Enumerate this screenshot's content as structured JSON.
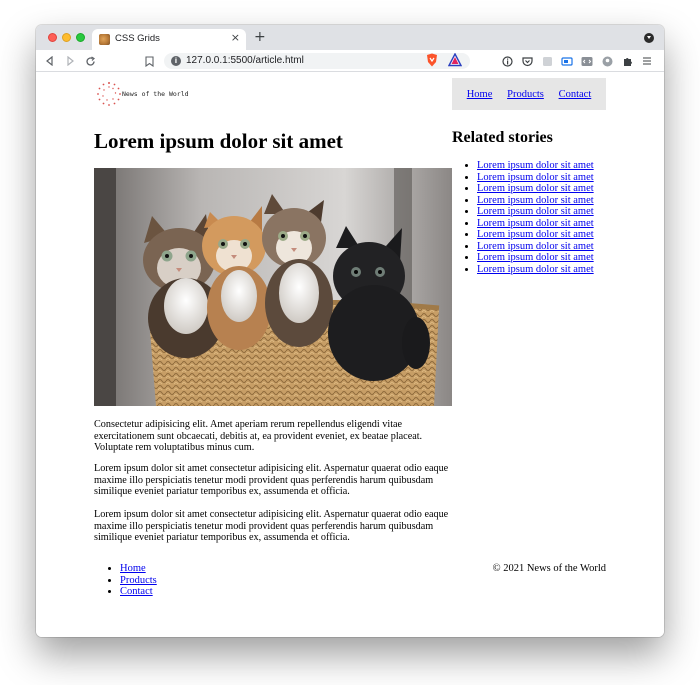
{
  "browser": {
    "tab_title": "CSS Grids",
    "tab_close": "×",
    "new_tab": "+",
    "url": "127.0.0.1:5500/article.html"
  },
  "site": {
    "logo_text": "News of the World",
    "nav": [
      "Home",
      "Products",
      "Contact"
    ]
  },
  "article": {
    "title": "Lorem ipsum dolor sit amet",
    "image_subject": "four-kittens-in-basket",
    "paragraphs": [
      "Consectetur adipisicing elit. Amet aperiam rerum repellendus eligendi vitae exercitationem sunt obcaecati, debitis at, ea provident eveniet, ex beatae placeat. Voluptate rem voluptatibus minus cum.",
      "Lorem ipsum dolor sit amet consectetur adipisicing elit. Aspernatur quaerat odio eaque maxime illo perspiciatis tenetur modi provident quas perferendis harum quibusdam similique eveniet pariatur temporibus ex, assumenda et officia.",
      "Lorem ipsum dolor sit amet consectetur adipisicing elit. Aspernatur quaerat odio eaque maxime illo perspiciatis tenetur modi provident quas perferendis harum quibusdam similique eveniet pariatur temporibus ex, assumenda et officia."
    ]
  },
  "related": {
    "title": "Related stories",
    "items": [
      "Lorem ipsum dolor sit amet",
      "Lorem ipsum dolor sit amet",
      "Lorem ipsum dolor sit amet",
      "Lorem ipsum dolor sit amet",
      "Lorem ipsum dolor sit amet",
      "Lorem ipsum dolor sit amet",
      "Lorem ipsum dolor sit amet",
      "Lorem ipsum dolor sit amet",
      "Lorem ipsum dolor sit amet",
      "Lorem ipsum dolor sit amet"
    ]
  },
  "footer": {
    "nav": [
      "Home",
      "Products",
      "Contact"
    ],
    "copyright": "© 2021 News of the World"
  },
  "colors": {
    "link": "#0000ee",
    "nav_background": "#e6e6e6",
    "logo_dots": "#d9534f"
  }
}
